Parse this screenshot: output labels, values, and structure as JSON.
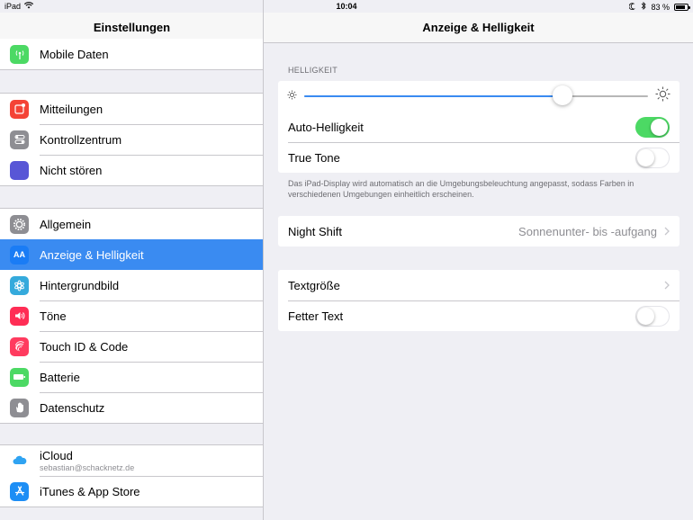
{
  "status_bar": {
    "device": "iPad",
    "time": "10:04",
    "battery_percent": "83 %",
    "battery_level": 0.83
  },
  "sidebar": {
    "title": "Einstellungen",
    "items": [
      {
        "label": "Mobile Daten",
        "icon": "antenna-icon",
        "color": "#4cd964"
      },
      {
        "label": "Mitteilungen",
        "icon": "notifications-icon",
        "color": "#f44336"
      },
      {
        "label": "Kontrollzentrum",
        "icon": "switches-icon",
        "color": "#8e8e93"
      },
      {
        "label": "Nicht stören",
        "icon": "moon-icon",
        "color": "#5856d6"
      },
      {
        "label": "Allgemein",
        "icon": "gear-icon",
        "color": "#8e8e93"
      },
      {
        "label": "Anzeige & Helligkeit",
        "icon": "aa-icon",
        "color": "#1a7cf5",
        "glyph": "AA"
      },
      {
        "label": "Hintergrundbild",
        "icon": "flower-icon",
        "color": "#35aadc"
      },
      {
        "label": "Töne",
        "icon": "speaker-icon",
        "color": "#ff2d55"
      },
      {
        "label": "Touch ID & Code",
        "icon": "fingerprint-icon",
        "color": "#ff3b5f"
      },
      {
        "label": "Batterie",
        "icon": "battery-icon",
        "color": "#4cd964"
      },
      {
        "label": "Datenschutz",
        "icon": "hand-icon",
        "color": "#8e8e93"
      },
      {
        "label": "iCloud",
        "sublabel": "sebastian@schacknetz.de",
        "icon": "cloud-icon",
        "color": "#ffffff"
      },
      {
        "label": "iTunes & App Store",
        "icon": "appstore-icon",
        "color": "#1d8ef5"
      }
    ]
  },
  "main": {
    "title": "Anzeige & Helligkeit",
    "brightness_header": "HELLIGKEIT",
    "brightness_level": 0.75,
    "auto_brightness_label": "Auto-Helligkeit",
    "auto_brightness_on": true,
    "true_tone_label": "True Tone",
    "true_tone_on": false,
    "true_tone_note": "Das iPad-Display wird automatisch an die Umgebungsbeleuchtung angepasst, sodass Farben in verschiedenen Umgebungen einheitlich erscheinen.",
    "night_shift_label": "Night Shift",
    "night_shift_value": "Sonnenunter- bis -aufgang",
    "text_size_label": "Textgröße",
    "bold_text_label": "Fetter Text",
    "bold_text_on": false
  }
}
